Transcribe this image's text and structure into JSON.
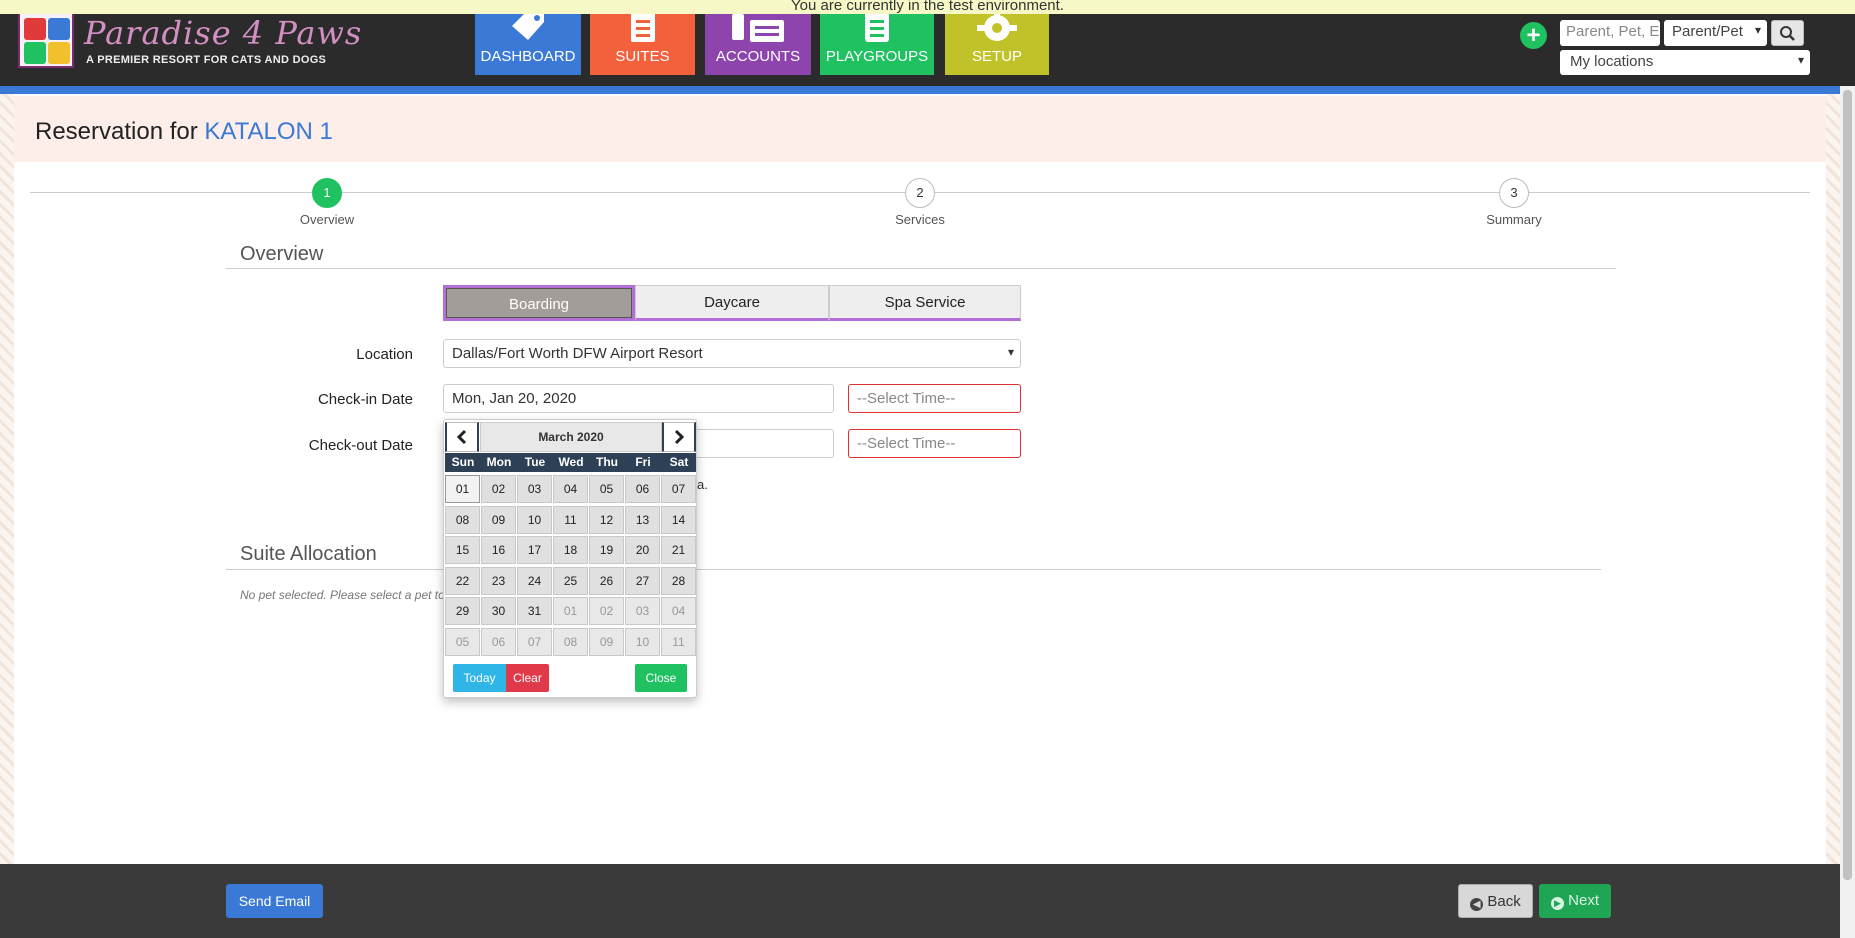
{
  "banner": "You are currently in the test environment.",
  "logo": {
    "title": "Paradise 4 Paws",
    "subtitle": "A PREMIER RESORT FOR CATS AND DOGS"
  },
  "nav": [
    {
      "label": "DASHBOARD",
      "color": "#3a79d5",
      "icon": "tag-icon"
    },
    {
      "label": "SUITES",
      "color": "#f2603c",
      "icon": "clipboard-icon"
    },
    {
      "label": "ACCOUNTS",
      "color": "#8e44ad",
      "icon": "id-card-icon"
    },
    {
      "label": "PLAYGROUPS",
      "color": "#1fc160",
      "icon": "list-icon"
    },
    {
      "label": "SETUP",
      "color": "#c1c22a",
      "icon": "gear-icon"
    }
  ],
  "search": {
    "placeholder": "Parent, Pet, E",
    "type_selected": "Parent/Pet",
    "location_selected": "My locations"
  },
  "header": {
    "prefix": "Reservation for",
    "name": "KATALON 1"
  },
  "steps": [
    {
      "num": "1",
      "label": "Overview"
    },
    {
      "num": "2",
      "label": "Services"
    },
    {
      "num": "3",
      "label": "Summary"
    }
  ],
  "overview": {
    "title": "Overview",
    "tabs": [
      "Boarding",
      "Daycare",
      "Spa Service"
    ],
    "location_label": "Location",
    "location_value": "Dallas/Fort Worth DFW Airport Resort",
    "checkin_label": "Check-in Date",
    "checkin_value": "Mon, Jan 20, 2020",
    "checkin_time_placeholder": "--Select Time--",
    "checkout_label": "Check-out Date",
    "checkout_time_placeholder": "--Select Time--",
    "partial_note": "a."
  },
  "suite": {
    "title": "Suite Allocation",
    "note": "No pet selected. Please select a pet to"
  },
  "calendar": {
    "month": "March 2020",
    "dow": [
      "Sun",
      "Mon",
      "Tue",
      "Wed",
      "Thu",
      "Fri",
      "Sat"
    ],
    "weeks": [
      [
        "01",
        "02",
        "03",
        "04",
        "05",
        "06",
        "07"
      ],
      [
        "08",
        "09",
        "10",
        "11",
        "12",
        "13",
        "14"
      ],
      [
        "15",
        "16",
        "17",
        "18",
        "19",
        "20",
        "21"
      ],
      [
        "22",
        "23",
        "24",
        "25",
        "26",
        "27",
        "28"
      ],
      [
        "29",
        "30",
        "31",
        "01",
        "02",
        "03",
        "04"
      ],
      [
        "05",
        "06",
        "07",
        "08",
        "09",
        "10",
        "11"
      ]
    ],
    "today": "Today",
    "clear": "Clear",
    "close": "Close"
  },
  "footer": {
    "send_email": "Send Email",
    "back": "Back",
    "next": "Next"
  }
}
